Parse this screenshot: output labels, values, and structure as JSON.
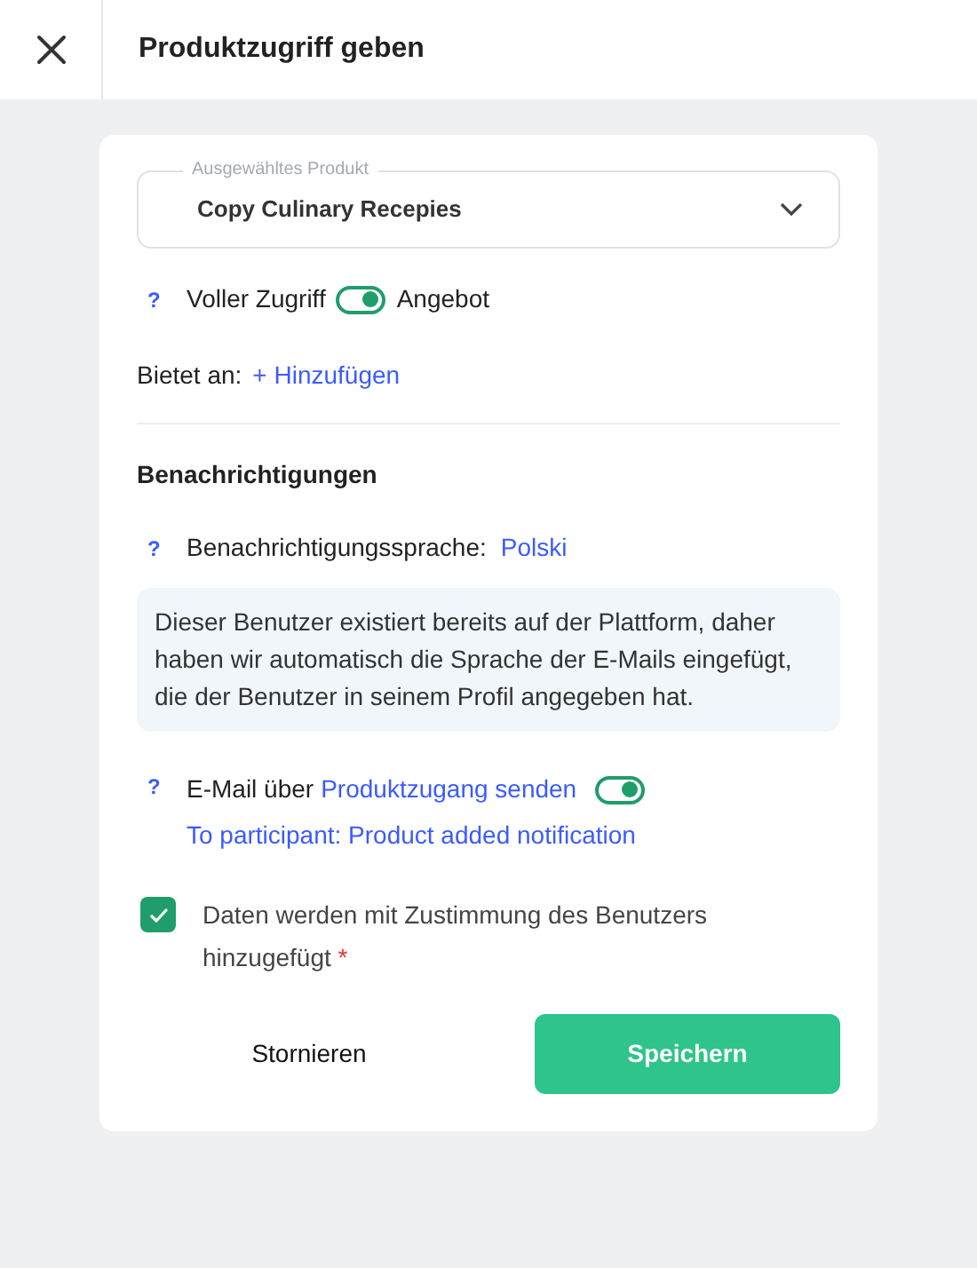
{
  "header": {
    "title": "Produktzugriff geben"
  },
  "product_select": {
    "label": "Ausgewähltes Produkt",
    "value": "Copy Culinary Recepies"
  },
  "access": {
    "help": "?",
    "left_label": "Voller Zugriff",
    "on": true,
    "right_label": "Angebot"
  },
  "offers": {
    "label": "Bietet an:",
    "link": "+ Hinzufügen"
  },
  "notifications": {
    "heading": "Benachrichtigungen",
    "language": {
      "help": "?",
      "label": "Benachrichtigungssprache:",
      "value": "Polski"
    },
    "info": "Dieser Benutzer existiert bereits auf der Plattform, daher haben wir automatisch die Sprache der E-Mails eingefügt, die der Benutzer in seinem Profil angegeben hat.",
    "email": {
      "help": "?",
      "prefix": "E-Mail über",
      "link": "Produktzugang senden",
      "on": true,
      "template": "To participant: Product added notification"
    }
  },
  "consent": {
    "checked": true,
    "text": "Daten werden mit Zustimmung des Benutzers hinzugefügt",
    "required_mark": "*"
  },
  "buttons": {
    "cancel": "Stornieren",
    "save": "Speichern"
  }
}
